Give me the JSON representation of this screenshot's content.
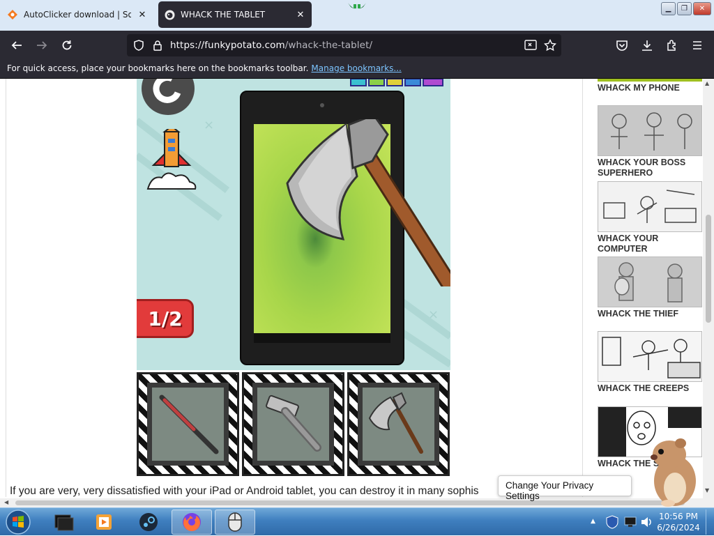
{
  "browser": {
    "tabs": [
      {
        "title": "AutoClicker download | SourceF",
        "active": false,
        "favicon": "sourceforge-icon"
      },
      {
        "title": "WHACK THE TABLET",
        "active": true,
        "favicon": "funkypotato-icon"
      }
    ],
    "url_host": "https://funkypotato.com",
    "url_path": "/whack-the-tablet/",
    "bookmarks_message": "For quick access, place your bookmarks here on the bookmarks toolbar.",
    "bookmarks_link": "Manage bookmarks..."
  },
  "game": {
    "counter": "1/2",
    "weapons": [
      {
        "name": "baseball-bat",
        "selected": false
      },
      {
        "name": "hammer",
        "selected": false
      },
      {
        "name": "axe",
        "selected": true
      }
    ]
  },
  "article": {
    "text": "If you are very, very dissatisfied with your iPad or Android tablet, you can destroy it in many sophis"
  },
  "sidebar": {
    "items": [
      {
        "label": "WHACK MY PHONE"
      },
      {
        "label": "WHACK YOUR BOSS SUPERHERO"
      },
      {
        "label": "WHACK YOUR COMPUTER"
      },
      {
        "label": "WHACK THE THIEF"
      },
      {
        "label": "WHACK THE CREEPS"
      },
      {
        "label": "WHACK THE SE"
      }
    ]
  },
  "privacy": {
    "label": "Change Your Privacy Settings"
  },
  "taskbar": {
    "clock_time": "10:56 PM",
    "clock_date": "6/26/2024"
  },
  "colors": {
    "browser_chrome": "#2b2a33",
    "tabstrip": "#dbe8f6",
    "game_bg": "#bfe3e1",
    "counter": "#e23b3b",
    "link": "#7cc4ff"
  }
}
